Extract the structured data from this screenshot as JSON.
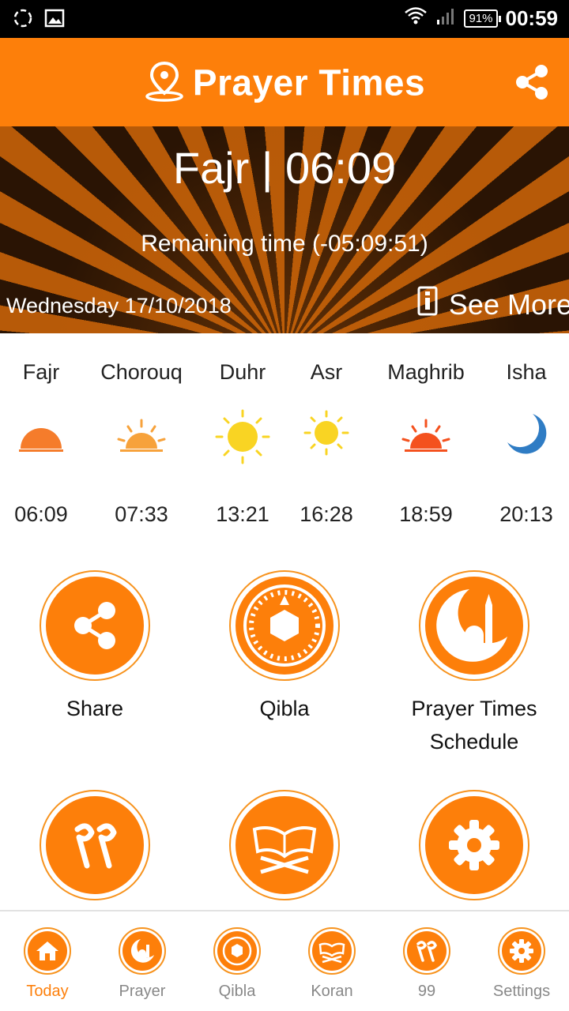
{
  "status_bar": {
    "battery": "91%",
    "time": "00:59"
  },
  "app_bar": {
    "title": "Prayer Times"
  },
  "banner": {
    "current_prayer": "Fajr | 06:09",
    "remaining": "Remaining time  (-05:09:51)",
    "date": "Wednesday 17/10/2018",
    "see_more": "See More"
  },
  "prayers": [
    {
      "name": "Fajr",
      "time": "06:09",
      "icon": "sunrise-icon"
    },
    {
      "name": "Chorouq",
      "time": "07:33",
      "icon": "sunrise-icon"
    },
    {
      "name": "Duhr",
      "time": "13:21",
      "icon": "sun-icon"
    },
    {
      "name": "Asr",
      "time": "16:28",
      "icon": "sun-icon"
    },
    {
      "name": "Maghrib",
      "time": "18:59",
      "icon": "sunset-icon"
    },
    {
      "name": "Isha",
      "time": "20:13",
      "icon": "moon-icon"
    }
  ],
  "tiles": [
    {
      "label": "Share",
      "icon": "share-icon"
    },
    {
      "label": "Qibla",
      "icon": "compass-icon"
    },
    {
      "label": "Prayer Times Schedule",
      "icon": "mosque-icon"
    },
    {
      "label": "",
      "icon": "ninety-nine-icon"
    },
    {
      "label": "",
      "icon": "koran-icon"
    },
    {
      "label": "",
      "icon": "gear-icon"
    }
  ],
  "bottom_nav": [
    {
      "label": "Today",
      "active": true
    },
    {
      "label": "Prayer"
    },
    {
      "label": "Qibla"
    },
    {
      "label": "Koran"
    },
    {
      "label": "99"
    },
    {
      "label": "Settings"
    }
  ],
  "colors": {
    "accent": "#fd7f0a",
    "ring": "#f7931e",
    "sun": "#f9d423",
    "sunrise": "#f57c2b",
    "sunset": "#f4511e",
    "moon": "#2f7cc4"
  }
}
